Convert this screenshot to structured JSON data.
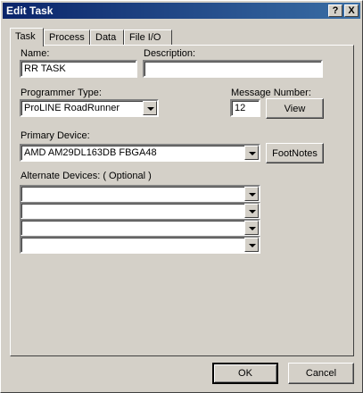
{
  "window": {
    "title": "Edit Task",
    "help_label": "?",
    "close_label": "X"
  },
  "tabs": [
    {
      "label": "Task",
      "active": true
    },
    {
      "label": "Process",
      "active": false
    },
    {
      "label": "Data",
      "active": false
    },
    {
      "label": "File I/O",
      "active": false
    }
  ],
  "task": {
    "name_label": "Name:",
    "name_value": "RR TASK",
    "description_label": "Description:",
    "description_value": "",
    "programmer_type_label": "Programmer Type:",
    "programmer_type_value": "ProLINE RoadRunner",
    "message_number_label": "Message Number:",
    "message_number_value": "12",
    "view_label": "View",
    "primary_device_label": "Primary Device:",
    "primary_device_value": "AMD AM29DL163DB FBGA48",
    "footnotes_label": "FootNotes",
    "alternate_devices_label": "Alternate Devices:  ( Optional )",
    "alternate_devices": [
      "",
      "",
      "",
      ""
    ]
  },
  "footer": {
    "ok_label": "OK",
    "cancel_label": "Cancel"
  }
}
